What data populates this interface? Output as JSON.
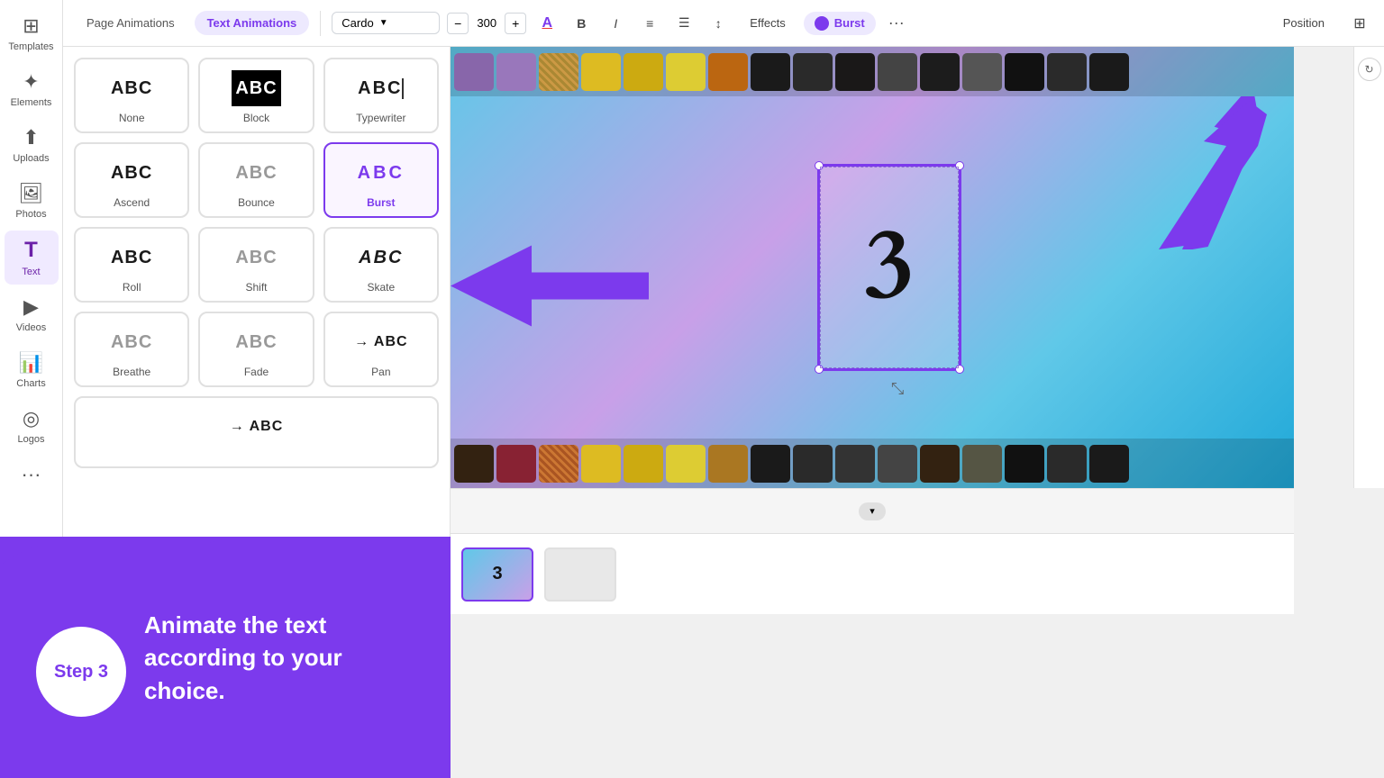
{
  "sidebar": {
    "items": [
      {
        "id": "templates",
        "label": "Templates",
        "icon": "⊞"
      },
      {
        "id": "elements",
        "label": "Elements",
        "icon": "✦"
      },
      {
        "id": "uploads",
        "label": "Uploads",
        "icon": "↑"
      },
      {
        "id": "photos",
        "label": "Photos",
        "icon": "🖼"
      },
      {
        "id": "text",
        "label": "Text",
        "icon": "T"
      },
      {
        "id": "videos",
        "label": "Videos",
        "icon": "▶"
      },
      {
        "id": "charts",
        "label": "Charts",
        "icon": "📊"
      },
      {
        "id": "logos",
        "label": "Logos",
        "icon": "◎"
      },
      {
        "id": "more",
        "label": "···",
        "icon": "···"
      }
    ]
  },
  "toolbar": {
    "tabs": [
      {
        "id": "page-animations",
        "label": "Page Animations"
      },
      {
        "id": "text-animations",
        "label": "Text Animations"
      }
    ],
    "active_tab": "text-animations",
    "font": "Cardo",
    "font_size": "300",
    "effects_label": "Effects",
    "burst_label": "Burst",
    "more_label": "···",
    "position_label": "Position",
    "toolbar_icons": {
      "color": "A",
      "bold": "B",
      "italic": "I",
      "align": "≡",
      "list": "☰",
      "spacing": "↕"
    }
  },
  "animations": {
    "items": [
      {
        "id": "none",
        "label": "None",
        "text": "ABC",
        "style": "normal"
      },
      {
        "id": "block",
        "label": "Block",
        "text": "ABC",
        "style": "block"
      },
      {
        "id": "typewriter",
        "label": "Typewriter",
        "text": "ABC",
        "style": "typewriter"
      },
      {
        "id": "ascend",
        "label": "Ascend",
        "text": "ABC",
        "style": "normal"
      },
      {
        "id": "bounce",
        "label": "Bounce",
        "text": "ABC",
        "style": "faded"
      },
      {
        "id": "burst",
        "label": "Burst",
        "text": "ABC",
        "style": "selected"
      },
      {
        "id": "roll",
        "label": "Roll",
        "text": "ABC",
        "style": "normal"
      },
      {
        "id": "shift",
        "label": "Shift",
        "text": "ABC",
        "style": "faded"
      },
      {
        "id": "skate",
        "label": "Skate",
        "text": "ABC",
        "style": "normal"
      },
      {
        "id": "breathe",
        "label": "Breathe",
        "text": "ABC",
        "style": "faded"
      },
      {
        "id": "fade",
        "label": "Fade",
        "text": "ABC",
        "style": "faded"
      },
      {
        "id": "pan",
        "label": "Pan",
        "text": "ABC",
        "style": "arrow"
      }
    ],
    "partial": {
      "text": "ABC",
      "arrow": "→"
    }
  },
  "canvas": {
    "card_number": "3"
  },
  "timeline": {
    "slide_number": "3"
  },
  "step": {
    "number": "Step 3",
    "text": "Animate the text according to your choice."
  },
  "film_colors_top": [
    "#8866aa",
    "#9977bb",
    "#aa8855",
    "#ddbb22",
    "#ccaa11",
    "#ddbb22",
    "#bb6611",
    "#222222",
    "#333333",
    "#555555",
    "#333333",
    "#444444",
    "#666666",
    "#222222",
    "#333333"
  ],
  "film_colors_bottom": [
    "#442211",
    "#883322",
    "#aa6633",
    "#ddbb22",
    "#ccaa11",
    "#ddbb22",
    "#aa8822",
    "#222222",
    "#333333",
    "#444444",
    "#555555",
    "#443322",
    "#666655",
    "#222222",
    "#333333"
  ]
}
